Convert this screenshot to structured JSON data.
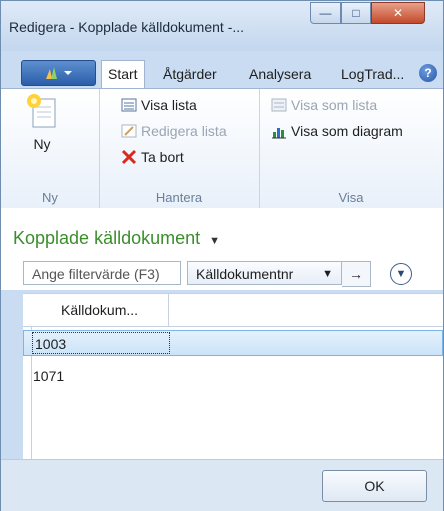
{
  "window": {
    "title": "Redigera - Kopplade källdokument -...",
    "minimize_label": "—",
    "maximize_label": "□",
    "close_label": "✕"
  },
  "ribbon": {
    "tabs": [
      {
        "label": "Start",
        "active": true
      },
      {
        "label": "Åtgärder",
        "active": false
      },
      {
        "label": "Analysera",
        "active": false
      },
      {
        "label": "LogTrad...",
        "active": false
      }
    ],
    "groups": {
      "ny": {
        "label": "Ny",
        "buttons": {
          "ny": "Ny"
        }
      },
      "hantera": {
        "label": "Hantera",
        "buttons": {
          "visa_lista": "Visa lista",
          "redigera_lista": "Redigera lista",
          "ta_bort": "Ta bort"
        }
      },
      "visa": {
        "label": "Visa",
        "buttons": {
          "visa_som_lista": "Visa som lista",
          "visa_som_diagram": "Visa som diagram"
        }
      }
    }
  },
  "page": {
    "title": "Kopplade källdokument",
    "filter": {
      "placeholder": "Ange filtervärde (F3)",
      "field": "Källdokumentnr"
    }
  },
  "table": {
    "columns": [
      "Källdokum..."
    ],
    "rows": [
      [
        "1003"
      ],
      [
        "1071"
      ]
    ],
    "selected_row": 0
  },
  "footer": {
    "ok_label": "OK"
  },
  "colors": {
    "title_green": "#3b8e2c",
    "selection_blue": "#cbe3f8"
  }
}
